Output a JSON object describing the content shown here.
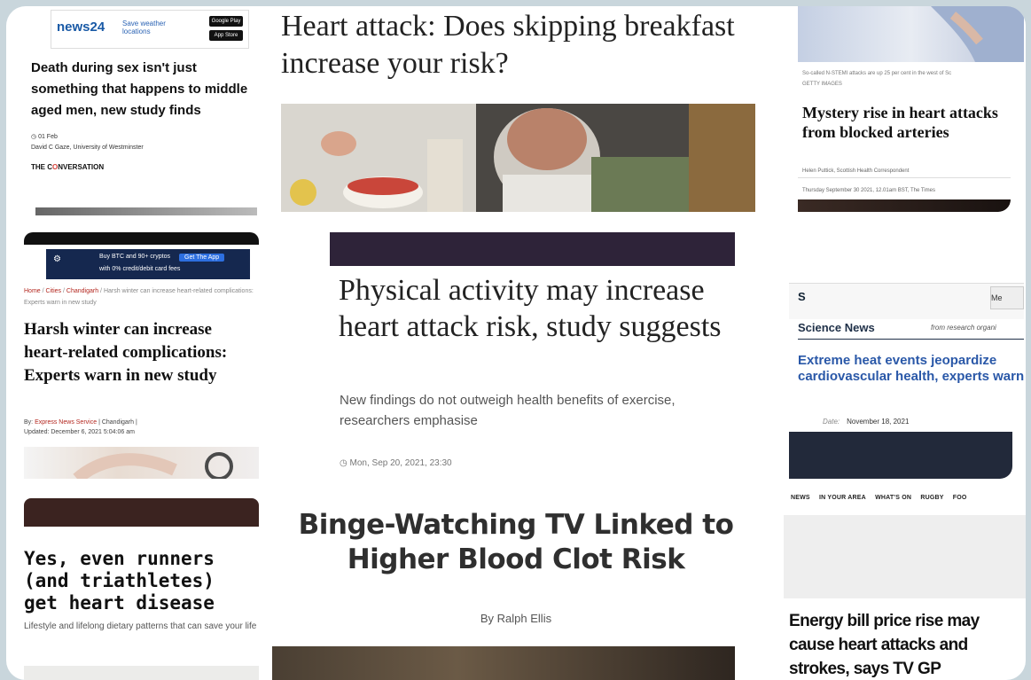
{
  "news24": {
    "logo": "news24",
    "save_weather": "Save weather locations",
    "google_play": "Google Play",
    "app_store": "App Store"
  },
  "conversation": {
    "headline": "Death during sex isn't just something that happens to middle aged men, new study finds",
    "date": "01 Feb",
    "author": "David C Gaze, University of Westminster",
    "brand_a": "THE C",
    "brand_b": "O",
    "brand_c": "NVERSATION"
  },
  "express": {
    "ad_text_1": "Buy BTC and 90+ cryptos",
    "ad_text_2": "with 0% credit/debit card fees",
    "ad_button": "Get The App",
    "breadcrumb": [
      "Home",
      "Cities",
      "Chandigarh"
    ],
    "breadcrumb_tail": "Harsh winter can increase heart-related complications: Experts warn in new study",
    "headline": "Harsh winter can increase heart-related complications: Experts warn in new study",
    "by_label": "By:",
    "author": "Express News Service",
    "location": "| Chandigarh |",
    "updated": "Updated: December 6, 2021 5:04:06 am"
  },
  "runners": {
    "headline": "Yes, even runners (and triathletes) get heart disease",
    "subtitle": "Lifestyle and lifelong dietary patterns that can save your life"
  },
  "breakfast": {
    "headline": "Heart attack: Does skipping breakfast increase your risk?"
  },
  "physical": {
    "headline": "Physical activity may increase heart attack risk, study suggests",
    "subtitle": "New findings do not outweigh health benefits of exercise, researchers emphasise",
    "date": "Mon, Sep 20, 2021, 23:30"
  },
  "binge": {
    "headline": "Binge-Watching TV Linked to Higher Blood Clot Risk",
    "byline": "By Ralph Ellis"
  },
  "times": {
    "caption": "So-called N-STEMI attacks are up 25 per cent in the west of Sc",
    "credit": "GETTY IMAGES",
    "headline": "Mystery rise in heart attacks from blocked arteries",
    "author": "Helen Puttick, Scottish Health Correspondent",
    "date": "Thursday September 30 2021, 12.01am BST, The Times"
  },
  "science_news": {
    "logo": "S",
    "menu_button": "Me",
    "section": "Science News",
    "from": "from research organi",
    "headline": "Extreme heat events jeopardize cardiovascular health, experts warn",
    "date_label": "Date:",
    "date": "November 18, 2021"
  },
  "wales": {
    "nav": [
      "NEWS",
      "IN YOUR AREA",
      "WHAT'S ON",
      "RUGBY",
      "FOO"
    ],
    "headline": "Energy bill price rise may cause heart attacks and strokes, says TV GP"
  }
}
